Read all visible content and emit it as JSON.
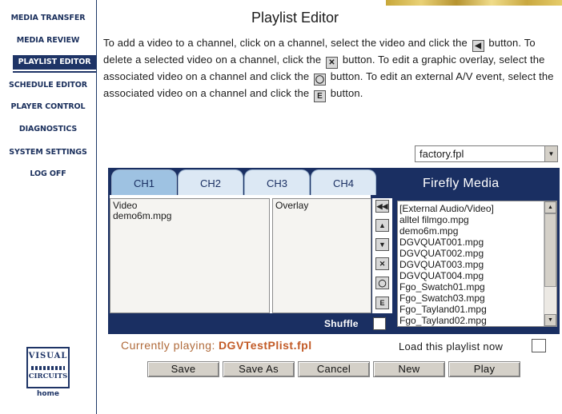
{
  "nav": {
    "items": [
      {
        "label": "MEDIA TRANSFER"
      },
      {
        "label": "MEDIA REVIEW"
      },
      {
        "label": "PLAYLIST EDITOR",
        "active": true
      },
      {
        "label": "SCHEDULE EDITOR"
      },
      {
        "label": "PLAYER CONTROL"
      },
      {
        "label": "DIAGNOSTICS"
      },
      {
        "label": "SYSTEM SETTINGS"
      },
      {
        "label": "LOG OFF"
      }
    ],
    "logo": {
      "line1": "VISUAL",
      "line2": "CIRCUITS"
    },
    "home_label": "home"
  },
  "page": {
    "title": "Playlist Editor",
    "intro": {
      "p1": "To add a video to a channel, click on a channel, select the video and click the",
      "p2": "button. To delete a selected video on a channel, click the",
      "p3": "button. To edit a graphic overlay, select the associated video on a channel and click the",
      "p4": "button. To edit an external A/V event, select the associated video on a channel and click the",
      "p5": "button."
    }
  },
  "playlist_select": {
    "value": "factory.fpl"
  },
  "editor": {
    "brand": "Firefly Media",
    "tabs": [
      {
        "label": "CH1",
        "active": true
      },
      {
        "label": "CH2"
      },
      {
        "label": "CH3"
      },
      {
        "label": "CH4"
      }
    ],
    "video_list": {
      "header": "Video",
      "items": [
        "demo6m.mpg"
      ]
    },
    "overlay_list": {
      "header": "Overlay"
    },
    "media_list": [
      "[External Audio/Video]",
      "alltel filmgo.mpg",
      "demo6m.mpg",
      "DGVQUAT001.mpg",
      "DGVQUAT002.mpg",
      "DGVQUAT003.mpg",
      "DGVQUAT004.mpg",
      "Fgo_Swatch01.mpg",
      "Fgo_Swatch03.mpg",
      "Fgo_Tayland01.mpg",
      "Fgo_Tayland02.mpg"
    ],
    "shuffle_label": "Shuffle",
    "controls": [
      {
        "icon": "add-to-channel-icon",
        "glyph": "◀◀"
      },
      {
        "icon": "move-up-icon",
        "glyph": "▲"
      },
      {
        "icon": "move-down-icon",
        "glyph": "▼"
      },
      {
        "icon": "delete-icon",
        "glyph": "✕"
      },
      {
        "icon": "overlay-icon",
        "glyph": "◯"
      },
      {
        "icon": "external-av-icon",
        "glyph": "E"
      }
    ]
  },
  "status": {
    "currently_playing_label": "Currently playing:",
    "currently_playing_file": "DGVTestPlist.fpl",
    "load_label": "Load this playlist now"
  },
  "buttons": {
    "save": "Save",
    "save_as": "Save As",
    "cancel": "Cancel",
    "new": "New",
    "play": "Play"
  },
  "colors": {
    "navy": "#1a2f62",
    "tab_active": "#9ec2e2",
    "tab": "#dce8f4",
    "playing": "#c25a26"
  }
}
